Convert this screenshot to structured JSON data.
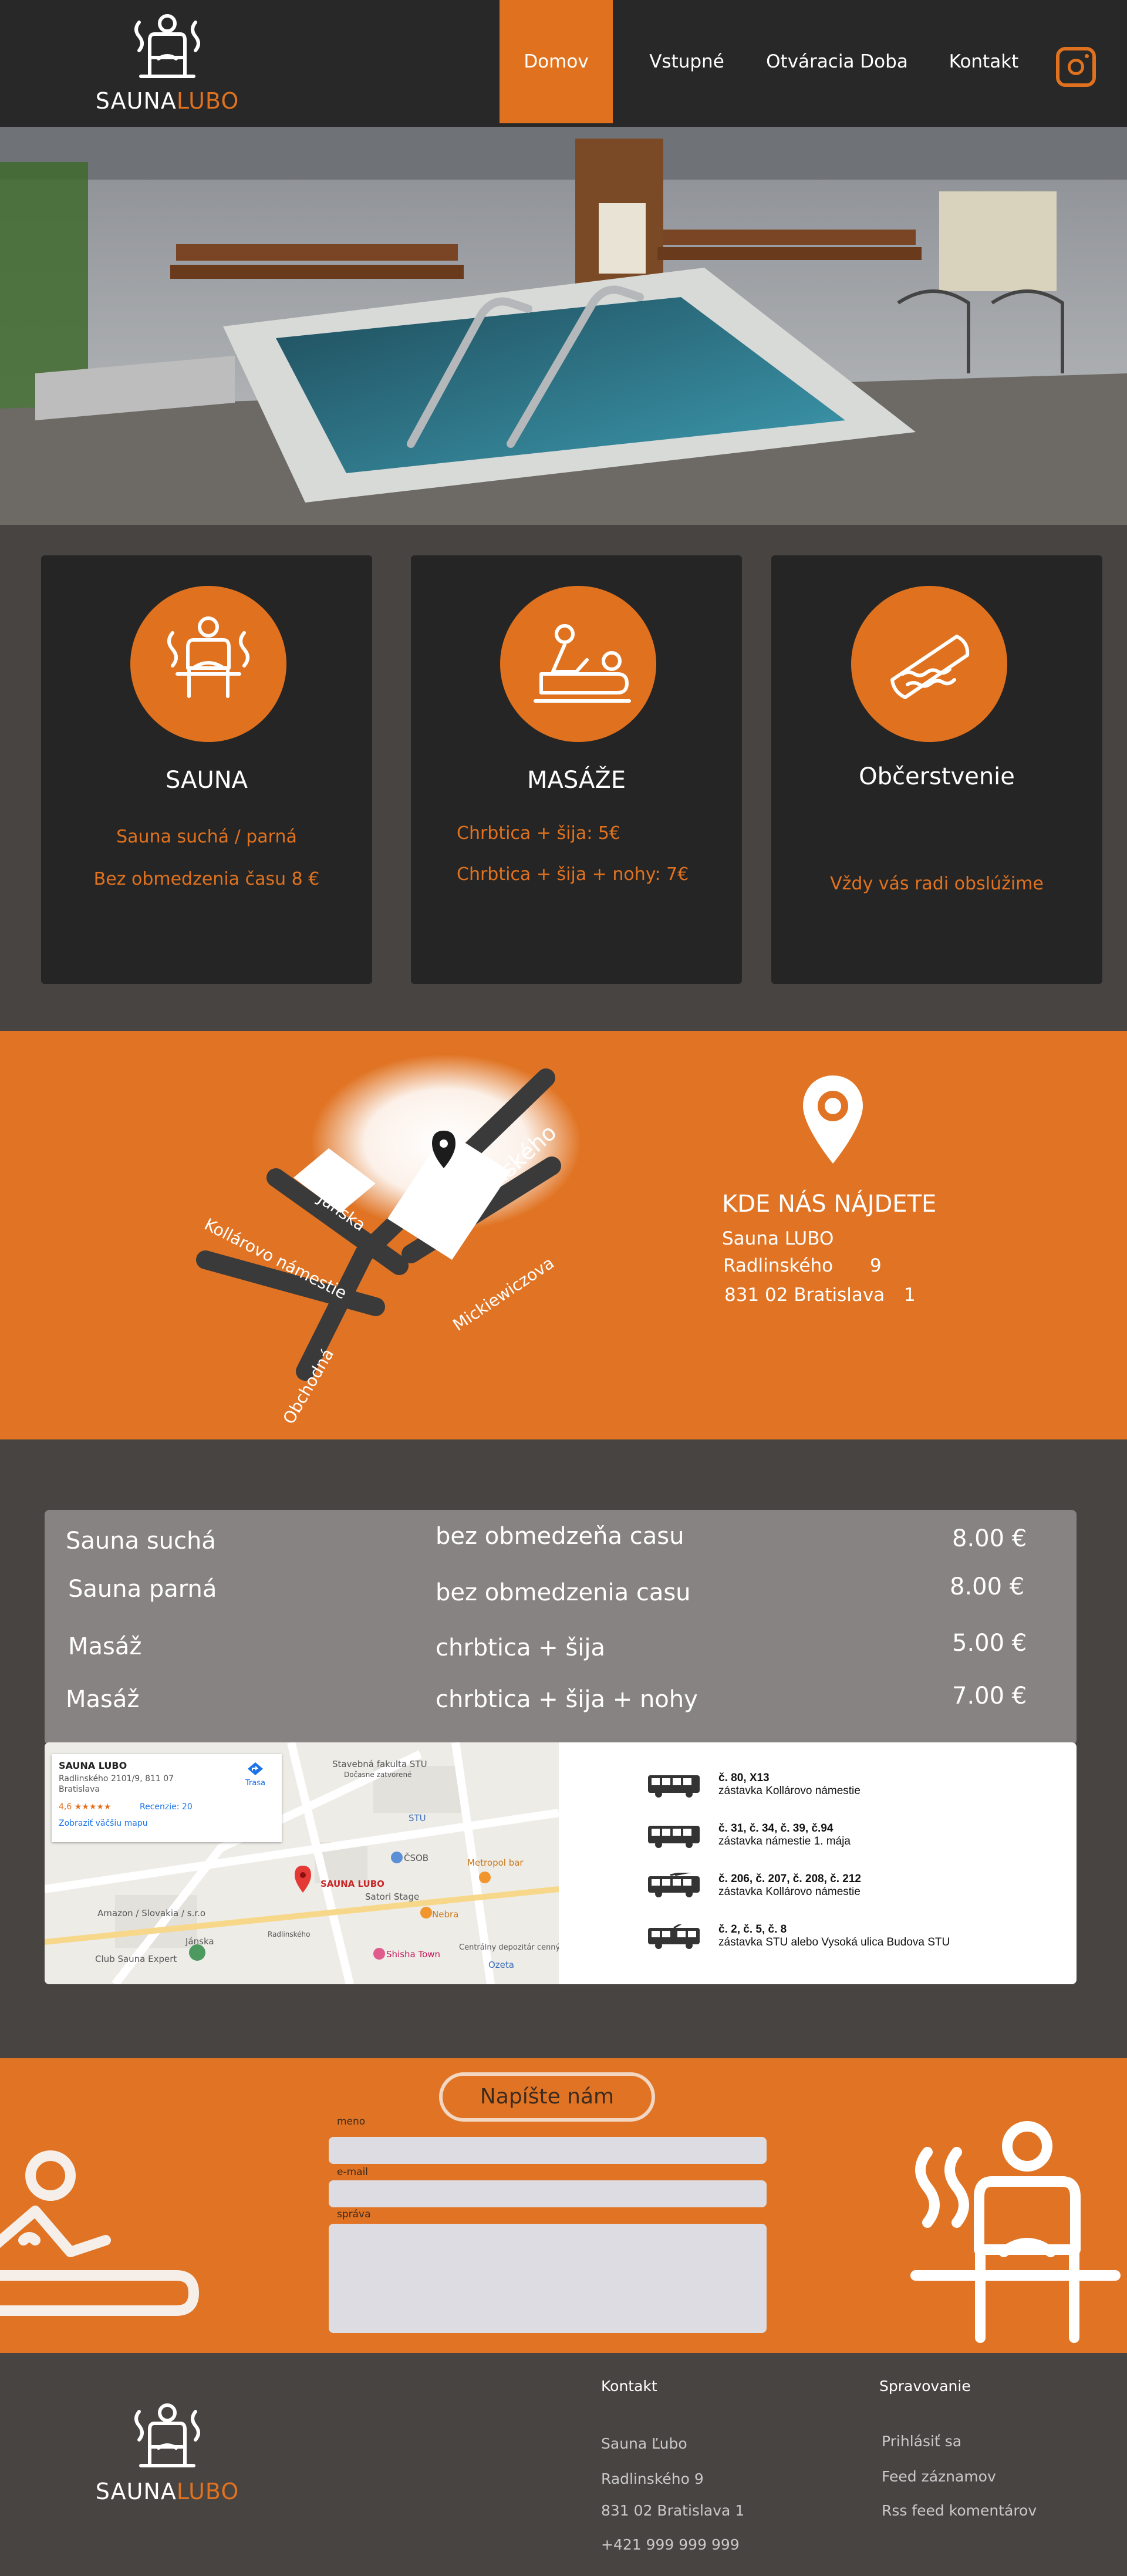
{
  "header": {
    "logo": {
      "word1": "SAUNA",
      "word2": "LUBO"
    },
    "nav": [
      {
        "label": "Domov",
        "active": true
      },
      {
        "label": "Vstupné",
        "active": false
      },
      {
        "label": "Otváracia Doba",
        "active": false
      },
      {
        "label": "Kontakt",
        "active": false
      }
    ],
    "instagram_icon": "instagram-icon"
  },
  "services": [
    {
      "icon": "sauna-person-icon",
      "title": "SAUNA",
      "lines": [
        "Sauna suchá / parná",
        "Bez obmedzenia času 8 €"
      ]
    },
    {
      "icon": "massage-icon",
      "title": "MASÁŽE",
      "lines": [
        "Chrbtica + šija: 5€",
        "Chrbtica + šija + nohy: 7€"
      ]
    },
    {
      "icon": "sandwich-icon",
      "title": "Občerstvenie",
      "lines": [
        "Vždy vás radi obslúžime"
      ]
    }
  ],
  "location": {
    "map_labels": [
      "Radlinského",
      "Jánska",
      "Kollárovo námestie",
      "Mickiewiczova",
      "Obchodná"
    ],
    "title": "KDE NÁS NÁJDETE",
    "name": "Sauna LUBO",
    "street": "Radlinského",
    "number": "9",
    "city": "831 02 Bratislava",
    "district": "1"
  },
  "prices": [
    {
      "name": "Sauna suchá",
      "desc": "bez obmedzeňa casu",
      "price": "8.00 €"
    },
    {
      "name": "Sauna parná",
      "desc": "bez obmedzenia casu",
      "price": "8.00 €"
    },
    {
      "name": "Masáž",
      "desc": "chrbtica + šija",
      "price": "5.00 €"
    },
    {
      "name": "Masáž",
      "desc": "chrbtica + šija + nohy",
      "price": "7.00 €"
    }
  ],
  "map": {
    "card_title": "SAUNA LUBO",
    "card_addr1": "Radlinského 2101/9, 811 07",
    "card_addr2": "Bratislava",
    "card_rating": "4,6 ★★★★★",
    "card_reviews": "Recenzie: 20",
    "card_link": "Zobraziť väčšiu mapu",
    "card_route": "Trasa",
    "pin_label": "SAUNA LUBO",
    "labels": [
      "Stavebná fakulta STU",
      "Dočasne zatvorené",
      "STU",
      "ČSOB",
      "Metropol bar",
      "Satori Stage",
      "Nebra",
      "Amazon / Slovakia / s.r.o",
      "Shisha Town",
      "Centrálny depozitár cenných papierov",
      "Jánska",
      "Club Sauna Expert",
      "Radlinského",
      "Ozeta"
    ]
  },
  "transport": [
    {
      "icon": "bus-icon",
      "lines": "č. 80, X13",
      "stop": "zástavka Kollárovo námestie"
    },
    {
      "icon": "bus-icon",
      "lines": "č. 31, č. 34, č. 39, č.94",
      "stop": "zástavka námestie 1. mája"
    },
    {
      "icon": "trolleybus-icon",
      "lines": "č. 206, č. 207, č. 208, č. 212",
      "stop": "zástavka Kollárovo námestie"
    },
    {
      "icon": "tram-icon",
      "lines": "č. 2, č. 5, č. 8",
      "stop": "zástavka STU alebo Vysoká ulica Budova STU"
    }
  ],
  "contact_form": {
    "title": "Napíšte nám",
    "name_label": "meno",
    "email_label": "e-mail",
    "message_label": "správa"
  },
  "footer": {
    "logo": {
      "word1": "SAUNA",
      "word2": "LUBO"
    },
    "contact_title": "Kontakt",
    "contact_lines": [
      "Sauna Ľubo",
      "Radlinského 9",
      "831 02 Bratislava 1",
      "+421 999 999 999"
    ],
    "admin_title": "Spravovanie",
    "admin_links": [
      "Prihlásiť sa",
      "Feed záznamov",
      "Rss feed komentárov"
    ]
  },
  "colors": {
    "accent": "#e0721f",
    "dark": "#282828",
    "panel": "#484442",
    "price_box": "#888383"
  }
}
